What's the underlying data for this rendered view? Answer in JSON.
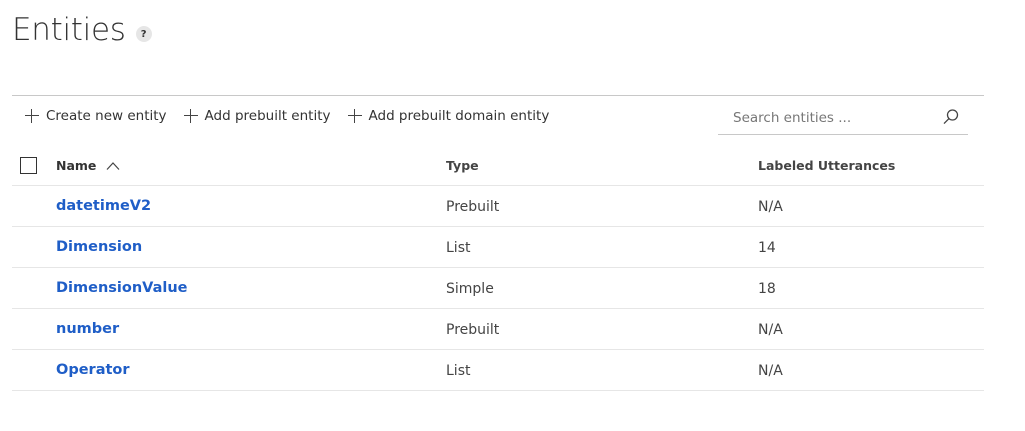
{
  "page": {
    "title": "Entities",
    "help_glyph": "?"
  },
  "toolbar": {
    "create_label": "Create new entity",
    "add_prebuilt_label": "Add prebuilt entity",
    "add_domain_label": "Add prebuilt domain entity"
  },
  "search": {
    "placeholder": "Search entities ...",
    "value": ""
  },
  "table": {
    "headers": {
      "name": "Name",
      "type": "Type",
      "labeled": "Labeled Utterances"
    },
    "sort": {
      "column": "Name",
      "direction": "ascending"
    },
    "rows": [
      {
        "name": "datetimeV2",
        "type": "Prebuilt",
        "labeled": "N/A"
      },
      {
        "name": "Dimension",
        "type": "List",
        "labeled": "14"
      },
      {
        "name": "DimensionValue",
        "type": "Simple",
        "labeled": "18"
      },
      {
        "name": "number",
        "type": "Prebuilt",
        "labeled": "N/A"
      },
      {
        "name": "Operator",
        "type": "List",
        "labeled": "N/A"
      }
    ]
  },
  "colors": {
    "link": "#1f5ec7",
    "text": "#333333",
    "divider": "#c8c8c8",
    "row_border": "#e6e6e6"
  },
  "icons": {
    "help": "help-icon",
    "add": "plus-icon",
    "search": "search-icon",
    "sort": "chevron-up-icon"
  }
}
